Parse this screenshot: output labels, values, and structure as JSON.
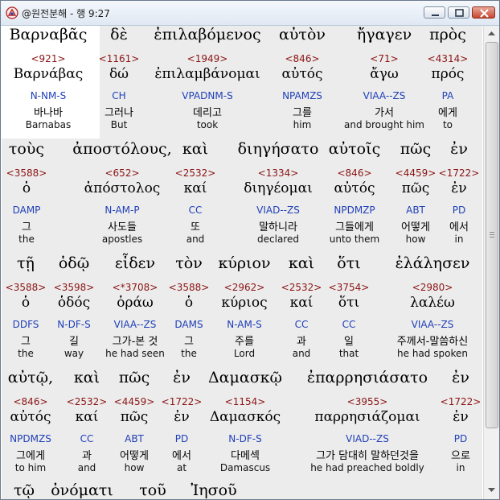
{
  "window": {
    "title": "@원전분해 - 행 9:27"
  },
  "rows": [
    [
      {
        "greek": "Βαρναβᾶς",
        "strong": "<921>",
        "lemma": "Βαρνάβας",
        "parse": "N-NM-S",
        "korean": "바나바",
        "english": "Barnabas"
      },
      {
        "greek": "δὲ",
        "strong": "<1161>",
        "lemma": "δώ",
        "parse": "CH",
        "korean": "그러나",
        "english": "But"
      },
      {
        "greek": "ἐπιλαβόμενος",
        "strong": "<1949>",
        "lemma": "ἐπιλαμβάνομαι",
        "parse": "VPADNM-S",
        "korean": "데리고",
        "english": "took"
      },
      {
        "greek": "αὐτὸν",
        "strong": "<846>",
        "lemma": "αὐτός",
        "parse": "NPAMZS",
        "korean": "그를",
        "english": "him"
      },
      {
        "greek": "ἤγαγεν",
        "strong": "<71>",
        "lemma": "ἄγω",
        "parse": "VIAA--ZS",
        "korean": "가서",
        "english": "and brought him"
      },
      {
        "greek": "πρὸς",
        "strong": "<4314>",
        "lemma": "πρός",
        "parse": "PA",
        "korean": "에게",
        "english": "to"
      }
    ],
    [
      {
        "greek": "τοὺς",
        "strong": "<3588>",
        "lemma": "ὁ",
        "parse": "DAMP",
        "korean": "그",
        "english": "the"
      },
      {
        "greek": "ἀποστόλους,",
        "strong": "<652>",
        "lemma": "ἀπόστολος",
        "parse": "N-AM-P",
        "korean": "사도들",
        "english": "apostles"
      },
      {
        "greek": "καὶ",
        "strong": "<2532>",
        "lemma": "καί",
        "parse": "CC",
        "korean": "또",
        "english": "and"
      },
      {
        "greek": "διηγήσατο",
        "strong": "<1334>",
        "lemma": "διηγέομαι",
        "parse": "VIAD--ZS",
        "korean": "말하니라",
        "english": "declared"
      },
      {
        "greek": "αὐτοῖς",
        "strong": "<846>",
        "lemma": "αὐτός",
        "parse": "NPDMZP",
        "korean": "그들에게",
        "english": "unto them"
      },
      {
        "greek": "πῶς",
        "strong": "<4459>",
        "lemma": "πῶς",
        "parse": "ABT",
        "korean": "어떻게",
        "english": "how"
      },
      {
        "greek": "ἐν",
        "strong": "<1722>",
        "lemma": "ἐν",
        "parse": "PD",
        "korean": "에서",
        "english": "in"
      }
    ],
    [
      {
        "greek": "τῇ",
        "strong": "<3588>",
        "lemma": "ὁ",
        "parse": "DDFS",
        "korean": "그",
        "english": "the"
      },
      {
        "greek": "ὁδῷ",
        "strong": "<3598>",
        "lemma": "ὁδός",
        "parse": "N-DF-S",
        "korean": "길",
        "english": "way"
      },
      {
        "greek": "εἶδεν",
        "strong": "<*3708>",
        "lemma": "ὁράω",
        "parse": "VIAA--ZS",
        "korean": "그가-본 것",
        "english": "he had seen"
      },
      {
        "greek": "τὸν",
        "strong": "<3588>",
        "lemma": "ὁ",
        "parse": "DAMS",
        "korean": "그",
        "english": "the"
      },
      {
        "greek": "κύριον",
        "strong": "<2962>",
        "lemma": "κύριος",
        "parse": "N-AM-S",
        "korean": "주를",
        "english": "Lord"
      },
      {
        "greek": "καὶ",
        "strong": "<2532>",
        "lemma": "καί",
        "parse": "CC",
        "korean": "과",
        "english": "and"
      },
      {
        "greek": "ὅτι",
        "strong": "<3754>",
        "lemma": "ὅτι",
        "parse": "CC",
        "korean": "일",
        "english": "that"
      },
      {
        "greek": "ἐλάλησεν",
        "strong": "<2980>",
        "lemma": "λαλέω",
        "parse": "VIAA--ZS",
        "korean": "주께서-말씀하신",
        "english": "he had spoken"
      }
    ],
    [
      {
        "greek": "αὐτῷ,",
        "strong": "<846>",
        "lemma": "αὐτός",
        "parse": "NPDMZS",
        "korean": "그에게",
        "english": "to him"
      },
      {
        "greek": "καὶ",
        "strong": "<2532>",
        "lemma": "καί",
        "parse": "CC",
        "korean": "과",
        "english": "and"
      },
      {
        "greek": "πῶς",
        "strong": "<4459>",
        "lemma": "πῶς",
        "parse": "ABT",
        "korean": "어떻게",
        "english": "how"
      },
      {
        "greek": "ἐν",
        "strong": "<1722>",
        "lemma": "ἐν",
        "parse": "PD",
        "korean": "에서",
        "english": "at"
      },
      {
        "greek": "Δαμασκῷ",
        "strong": "<1154>",
        "lemma": "Δαμασκός",
        "parse": "N-DF-S",
        "korean": "다메섹",
        "english": "Damascus"
      },
      {
        "greek": "ἐπαρρησιάσατο",
        "strong": "<3955>",
        "lemma": "παρρησιάζομαι",
        "parse": "VIAD--ZS",
        "korean": "그가 담대히 말하던것을",
        "english": "he had preached boldly"
      },
      {
        "greek": "ἐν",
        "strong": "<1722>",
        "lemma": "ἐν",
        "parse": "PD",
        "korean": "으로",
        "english": "in"
      }
    ],
    [
      {
        "greek": "τῷ",
        "strong": "",
        "lemma": "",
        "parse": "",
        "korean": "",
        "english": ""
      },
      {
        "greek": "ὀνόματι",
        "strong": "",
        "lemma": "",
        "parse": "",
        "korean": "",
        "english": ""
      },
      {
        "greek": "τοῦ",
        "strong": "",
        "lemma": "",
        "parse": "",
        "korean": "",
        "english": ""
      },
      {
        "greek": "Ἰησοῦ",
        "strong": "",
        "lemma": "",
        "parse": "",
        "korean": "",
        "english": ""
      }
    ]
  ],
  "colors": {
    "strong": "#8b1414",
    "parse": "#1f3fb8",
    "close_button": "#c8462f"
  }
}
